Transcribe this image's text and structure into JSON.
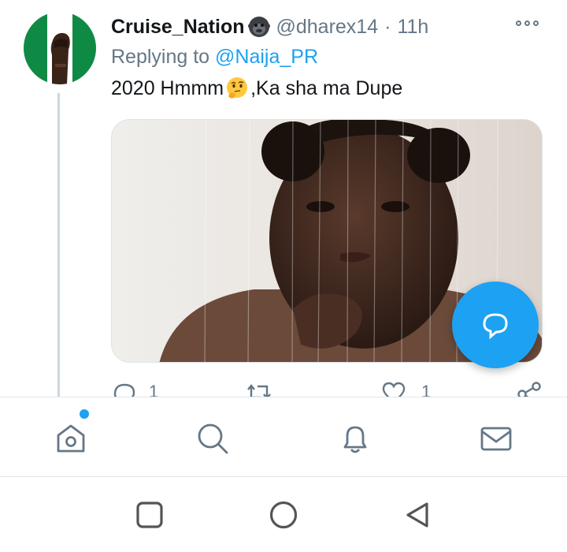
{
  "tweet": {
    "display_name": "Cruise_Nation",
    "name_emoji": "gorilla-emoji",
    "handle": "@dharex14",
    "separator": "·",
    "time": "11h",
    "reply_prefix": "Replying to",
    "reply_to": "@Naija_PR",
    "text_part1": "2020 Hmmm",
    "text_emoji": "thinking-face-emoji",
    "text_part2": ",Ka sha ma Dupe",
    "media_description_icon": "photo-of-man-in-shower"
  },
  "actions": {
    "reply_count": "1",
    "like_count": "1"
  },
  "tabs": [
    "home-icon",
    "search-icon",
    "notifications-icon",
    "messages-icon"
  ],
  "system_nav": [
    "recent-apps-icon",
    "home-circle-icon",
    "back-icon"
  ],
  "colors": {
    "accent": "#1da1f2",
    "muted": "#657786",
    "text": "#14171a"
  }
}
